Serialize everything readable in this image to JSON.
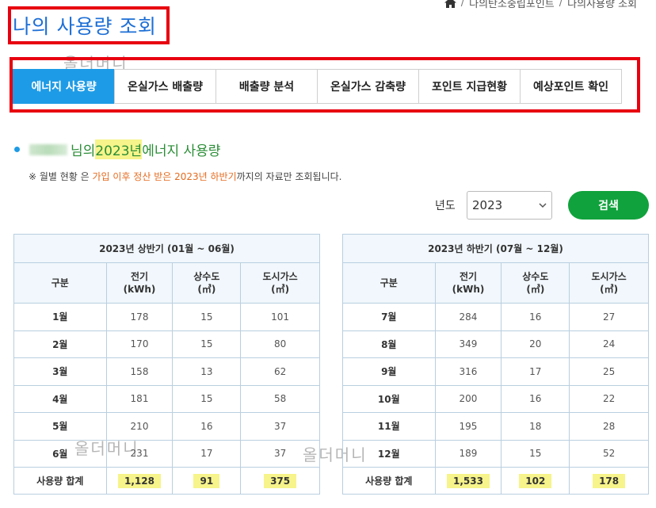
{
  "breadcrumb": {
    "items": [
      "나의탄소중립포인트",
      "나의사용량 조회"
    ],
    "sep": "/"
  },
  "page_title": "나의 사용량 조회",
  "watermark": "올더머니",
  "tabs": [
    {
      "label": "에너지 사용량",
      "active": true
    },
    {
      "label": "온실가스 배출량",
      "active": false
    },
    {
      "label": "배출량 분석",
      "active": false
    },
    {
      "label": "온실가스 감축량",
      "active": false
    },
    {
      "label": "포인트 지급현황",
      "active": false
    },
    {
      "label": "예상포인트 확인",
      "active": false
    }
  ],
  "section": {
    "name_suffix": "님의 ",
    "year_text": "2023년 ",
    "rest": "에너지 사용량"
  },
  "notice": {
    "prefix": "※ 월별 현황 은 ",
    "highlight": "가입 이후 정산 받은 2023년 하반기",
    "suffix": "까지의 자료만 조회됩니다."
  },
  "filter": {
    "label": "년도",
    "selected": "2023",
    "search_label": "검색"
  },
  "colors": {
    "accent": "#1e9be6",
    "alert": "#e8000f",
    "button": "#10a23c",
    "highlight": "#f6f48a"
  },
  "tables": [
    {
      "caption": "2023년 상반기 (01월 ~ 06월)",
      "headers": [
        [
          "구분",
          ""
        ],
        [
          "전기",
          "(kWh)"
        ],
        [
          "상수도",
          "(㎥)"
        ],
        [
          "도시가스",
          "(㎥)"
        ]
      ],
      "rows": [
        [
          "1월",
          "178",
          "15",
          "101"
        ],
        [
          "2월",
          "170",
          "15",
          "80"
        ],
        [
          "3월",
          "158",
          "13",
          "62"
        ],
        [
          "4월",
          "181",
          "15",
          "58"
        ],
        [
          "5월",
          "210",
          "16",
          "37"
        ],
        [
          "6월",
          "231",
          "17",
          "37"
        ]
      ],
      "total": [
        "사용량 합계",
        "1,128",
        "91",
        "375"
      ]
    },
    {
      "caption": "2023년 하반기 (07월 ~ 12월)",
      "headers": [
        [
          "구분",
          ""
        ],
        [
          "전기",
          "(kWh)"
        ],
        [
          "상수도",
          "(㎥)"
        ],
        [
          "도시가스",
          "(㎥)"
        ]
      ],
      "rows": [
        [
          "7월",
          "284",
          "16",
          "27"
        ],
        [
          "8월",
          "349",
          "20",
          "24"
        ],
        [
          "9월",
          "316",
          "17",
          "25"
        ],
        [
          "10월",
          "200",
          "16",
          "22"
        ],
        [
          "11월",
          "195",
          "18",
          "28"
        ],
        [
          "12월",
          "189",
          "15",
          "52"
        ]
      ],
      "total": [
        "사용량 합계",
        "1,533",
        "102",
        "178"
      ]
    }
  ]
}
